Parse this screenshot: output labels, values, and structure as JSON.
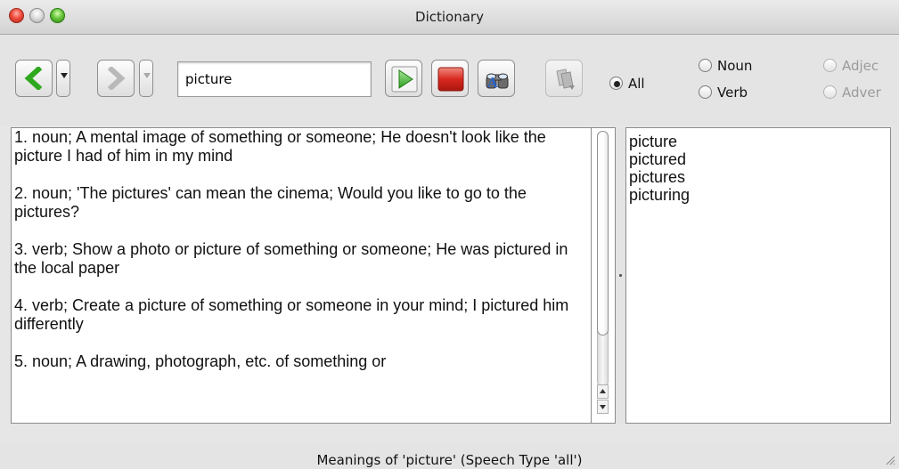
{
  "window": {
    "title": "Dictionary"
  },
  "toolbar": {
    "back_icon": "chevron-left-icon",
    "forward_icon": "chevron-right-icon",
    "search_value": "picture",
    "lookup_icon": "play-icon",
    "stop_icon": "stop-icon",
    "find_icon": "binoculars-icon",
    "copy_icon": "copy-documents-icon",
    "radio_all": "All",
    "radio_noun": "Noun",
    "radio_verb": "Verb",
    "radio_adjective": "Adjec",
    "radio_adverb": "Adver",
    "selected_speech_type": "All"
  },
  "meanings": [
    "1. noun; A mental image of something or someone; He doesn't look like the picture I had of him in my mind",
    "2. noun; 'The pictures' can mean the cinema; Would you like to go to the pictures?",
    "3. verb; Show a photo or picture of something or someone; He was pictured in the local paper",
    "4. verb; Create a picture of something or someone in your mind; I pictured him differently",
    "5. noun; A drawing, photograph, etc. of something or"
  ],
  "word_forms": [
    "picture",
    "pictured",
    "pictures",
    "picturing"
  ],
  "status": {
    "text": "Meanings of 'picture' (Speech Type 'all')"
  },
  "colors": {
    "play_green": "#3bb52a",
    "stop_red": "#d8281f",
    "nav_green": "#2ea81e"
  }
}
